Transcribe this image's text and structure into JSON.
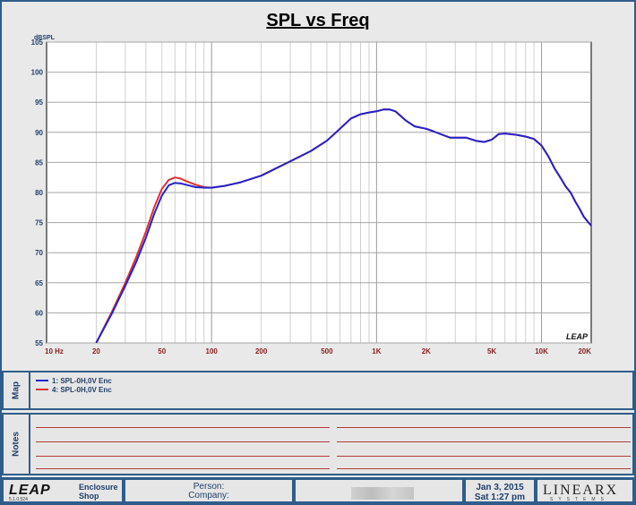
{
  "title": "SPL vs Freq",
  "chart_data": {
    "type": "line",
    "ylabel": "dBSPL",
    "xscale": "log",
    "xlim": [
      10,
      20000
    ],
    "ylim": [
      55,
      105
    ],
    "grid": true,
    "yticks": [
      "55",
      "60",
      "65",
      "70",
      "75",
      "80",
      "85",
      "90",
      "95",
      "100",
      "105"
    ],
    "xtick_labels": [
      {
        "value": 10,
        "label": "10  Hz"
      },
      {
        "value": 20,
        "label": "20"
      },
      {
        "value": 50,
        "label": "50"
      },
      {
        "value": 100,
        "label": "100"
      },
      {
        "value": 200,
        "label": "200"
      },
      {
        "value": 500,
        "label": "500"
      },
      {
        "value": 1000,
        "label": "1K"
      },
      {
        "value": 2000,
        "label": "2K"
      },
      {
        "value": 5000,
        "label": "5K"
      },
      {
        "value": 10000,
        "label": "10K"
      },
      {
        "value": 20000,
        "label": "20K"
      }
    ],
    "series": [
      {
        "name": "1: SPL-0H,0V Enc",
        "color": "#2323cc",
        "x": [
          20,
          25,
          30,
          35,
          40,
          45,
          50,
          55,
          60,
          65,
          70,
          80,
          90,
          100,
          120,
          150,
          200,
          300,
          400,
          500,
          600,
          700,
          800,
          900,
          1000,
          1100,
          1200,
          1300,
          1500,
          1700,
          2000,
          2200,
          2500,
          2800,
          3000,
          3500,
          4000,
          4500,
          5000,
          5500,
          6000,
          7000,
          8000,
          9000,
          10000,
          11000,
          12000,
          13000,
          14000,
          15000,
          16000,
          17000,
          18000,
          19000,
          20000
        ],
        "y": [
          55,
          60,
          64.5,
          68.5,
          72.5,
          76.5,
          79.5,
          81.2,
          81.6,
          81.5,
          81.3,
          80.9,
          80.8,
          80.8,
          81.1,
          81.7,
          82.8,
          85.2,
          86.9,
          88.6,
          90.6,
          92.3,
          93.0,
          93.3,
          93.5,
          93.8,
          93.8,
          93.5,
          92.0,
          91.0,
          90.6,
          90.2,
          89.6,
          89.1,
          89.1,
          89.1,
          88.6,
          88.4,
          88.8,
          89.7,
          89.8,
          89.6,
          89.3,
          88.9,
          87.8,
          86.0,
          84.0,
          82.5,
          81.0,
          80.0,
          78.5,
          77.3,
          76.0,
          75.2,
          74.5
        ]
      },
      {
        "name": "4: SPL-0H,0V Enc",
        "color": "#e03030",
        "x": [
          20,
          25,
          30,
          35,
          40,
          45,
          50,
          55,
          60,
          65,
          70,
          80,
          90,
          100,
          120,
          150,
          200,
          300,
          400,
          500,
          600,
          700,
          800,
          900,
          1000,
          1100,
          1200,
          1300,
          1500,
          1700,
          2000,
          2200,
          2500,
          2800,
          3000,
          3500,
          4000,
          4500,
          5000,
          5500,
          6000,
          7000,
          8000,
          9000,
          10000,
          11000,
          12000,
          13000,
          14000,
          15000,
          16000,
          17000,
          18000,
          19000,
          20000
        ],
        "y": [
          55,
          60.3,
          65,
          69.3,
          73.5,
          77.6,
          80.6,
          82.1,
          82.5,
          82.3,
          81.9,
          81.3,
          80.9,
          80.8,
          81.1,
          81.7,
          82.8,
          85.2,
          86.9,
          88.6,
          90.6,
          92.3,
          93.0,
          93.3,
          93.5,
          93.8,
          93.8,
          93.5,
          92.0,
          91.0,
          90.6,
          90.2,
          89.6,
          89.1,
          89.1,
          89.1,
          88.6,
          88.4,
          88.8,
          89.7,
          89.8,
          89.6,
          89.3,
          88.9,
          87.8,
          86.0,
          84.0,
          82.5,
          81.0,
          80.0,
          78.5,
          77.3,
          76.0,
          75.2,
          74.5
        ]
      }
    ]
  },
  "plot_logo": "LEAP",
  "panels": {
    "map_label": "Map",
    "notes_label": "Notes"
  },
  "footer": {
    "logo": "LEAP",
    "version": "5.1.0.524",
    "app_line1": "Enclosure",
    "app_line2": "Shop",
    "person_label": "Person:",
    "company_label": "Company:",
    "date": "Jan  3, 2015",
    "time": "Sat  1:27 pm",
    "brand": "LINEARX",
    "brand_sub": "SYSTEMS"
  }
}
